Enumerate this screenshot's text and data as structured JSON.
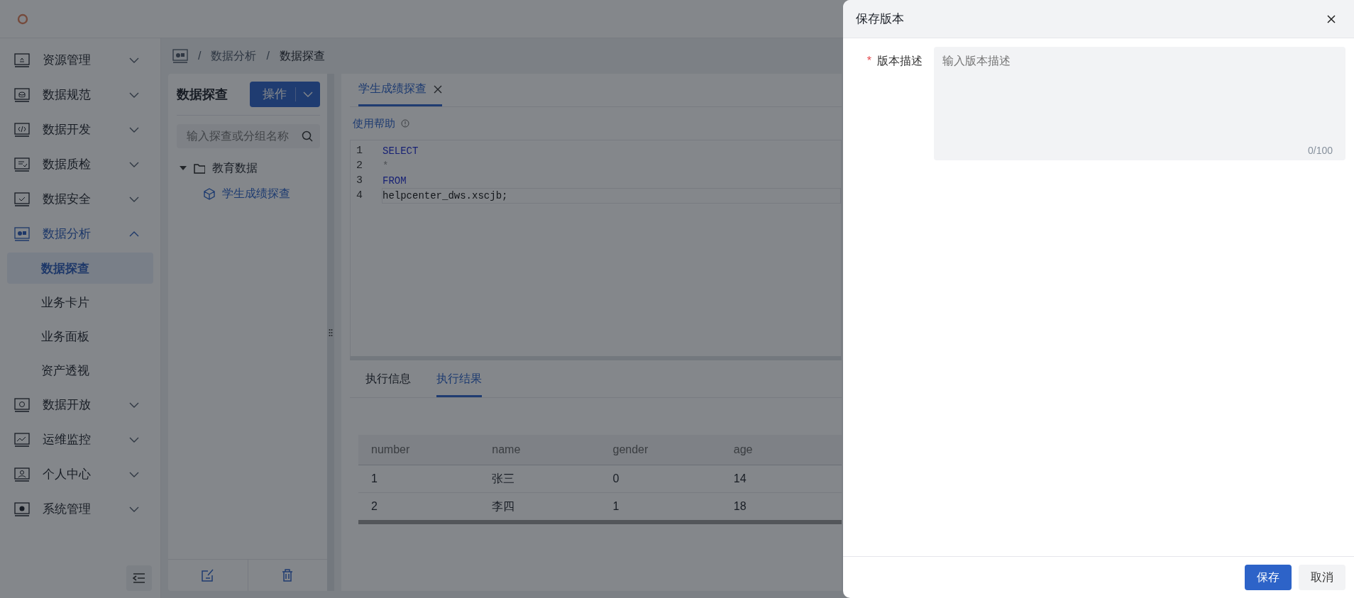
{
  "sidebar": {
    "items": [
      {
        "label": "资源管理",
        "expanded": false,
        "selected": false
      },
      {
        "label": "数据规范",
        "expanded": false,
        "selected": false
      },
      {
        "label": "数据开发",
        "expanded": false,
        "selected": false
      },
      {
        "label": "数据质检",
        "expanded": false,
        "selected": false
      },
      {
        "label": "数据安全",
        "expanded": false,
        "selected": false
      },
      {
        "label": "数据分析",
        "expanded": true,
        "selected": true,
        "children": [
          {
            "label": "数据探查",
            "selected": true
          },
          {
            "label": "业务卡片",
            "selected": false
          },
          {
            "label": "业务面板",
            "selected": false
          },
          {
            "label": "资产透视",
            "selected": false
          }
        ]
      },
      {
        "label": "数据开放",
        "expanded": false,
        "selected": false
      },
      {
        "label": "运维监控",
        "expanded": false,
        "selected": false
      },
      {
        "label": "个人中心",
        "expanded": false,
        "selected": false
      },
      {
        "label": "系统管理",
        "expanded": false,
        "selected": false
      }
    ]
  },
  "breadcrumb": [
    {
      "separator": "/",
      "label": "数据分析",
      "current": false
    },
    {
      "separator": "/",
      "label": "数据探查",
      "current": true
    }
  ],
  "explorer": {
    "title": "数据探查",
    "action_button": "操作",
    "search": {
      "placeholder": "输入探查或分组名称"
    },
    "tree": [
      {
        "label": "教育数据",
        "kind": "folder",
        "expanded": true,
        "selected": false,
        "children": [
          {
            "label": "学生成绩探查",
            "kind": "query",
            "selected": true
          }
        ]
      }
    ]
  },
  "editor": {
    "tabs": [
      {
        "label": "学生成绩探查",
        "selected": true
      }
    ],
    "help_link": "使用帮助",
    "code_lines": [
      {
        "number": "1",
        "text": "SELECT",
        "kind": "keyword",
        "active": false
      },
      {
        "number": "2",
        "text": "*",
        "kind": "operator",
        "active": false
      },
      {
        "number": "3",
        "text": "FROM",
        "kind": "keyword",
        "active": false
      },
      {
        "number": "4",
        "text": "helpcenter_dws.xscjb;",
        "kind": "identifier",
        "active": true
      }
    ]
  },
  "results": {
    "tabs": [
      {
        "label": "执行信息",
        "selected": false
      },
      {
        "label": "执行结果",
        "selected": true
      }
    ],
    "table": {
      "columns": [
        "number",
        "name",
        "gender",
        "age"
      ],
      "rows": [
        [
          "1",
          "张三",
          "0",
          "14"
        ],
        [
          "2",
          "李四",
          "1",
          "18"
        ]
      ]
    }
  },
  "drawer": {
    "title": "保存版本",
    "fields": [
      {
        "label": "版本描述",
        "required_mark": "*",
        "placeholder": "输入版本描述",
        "counter": "0/100"
      }
    ],
    "buttons": [
      {
        "label": "保存",
        "kind": "primary"
      },
      {
        "label": "取消",
        "kind": "default"
      }
    ]
  }
}
